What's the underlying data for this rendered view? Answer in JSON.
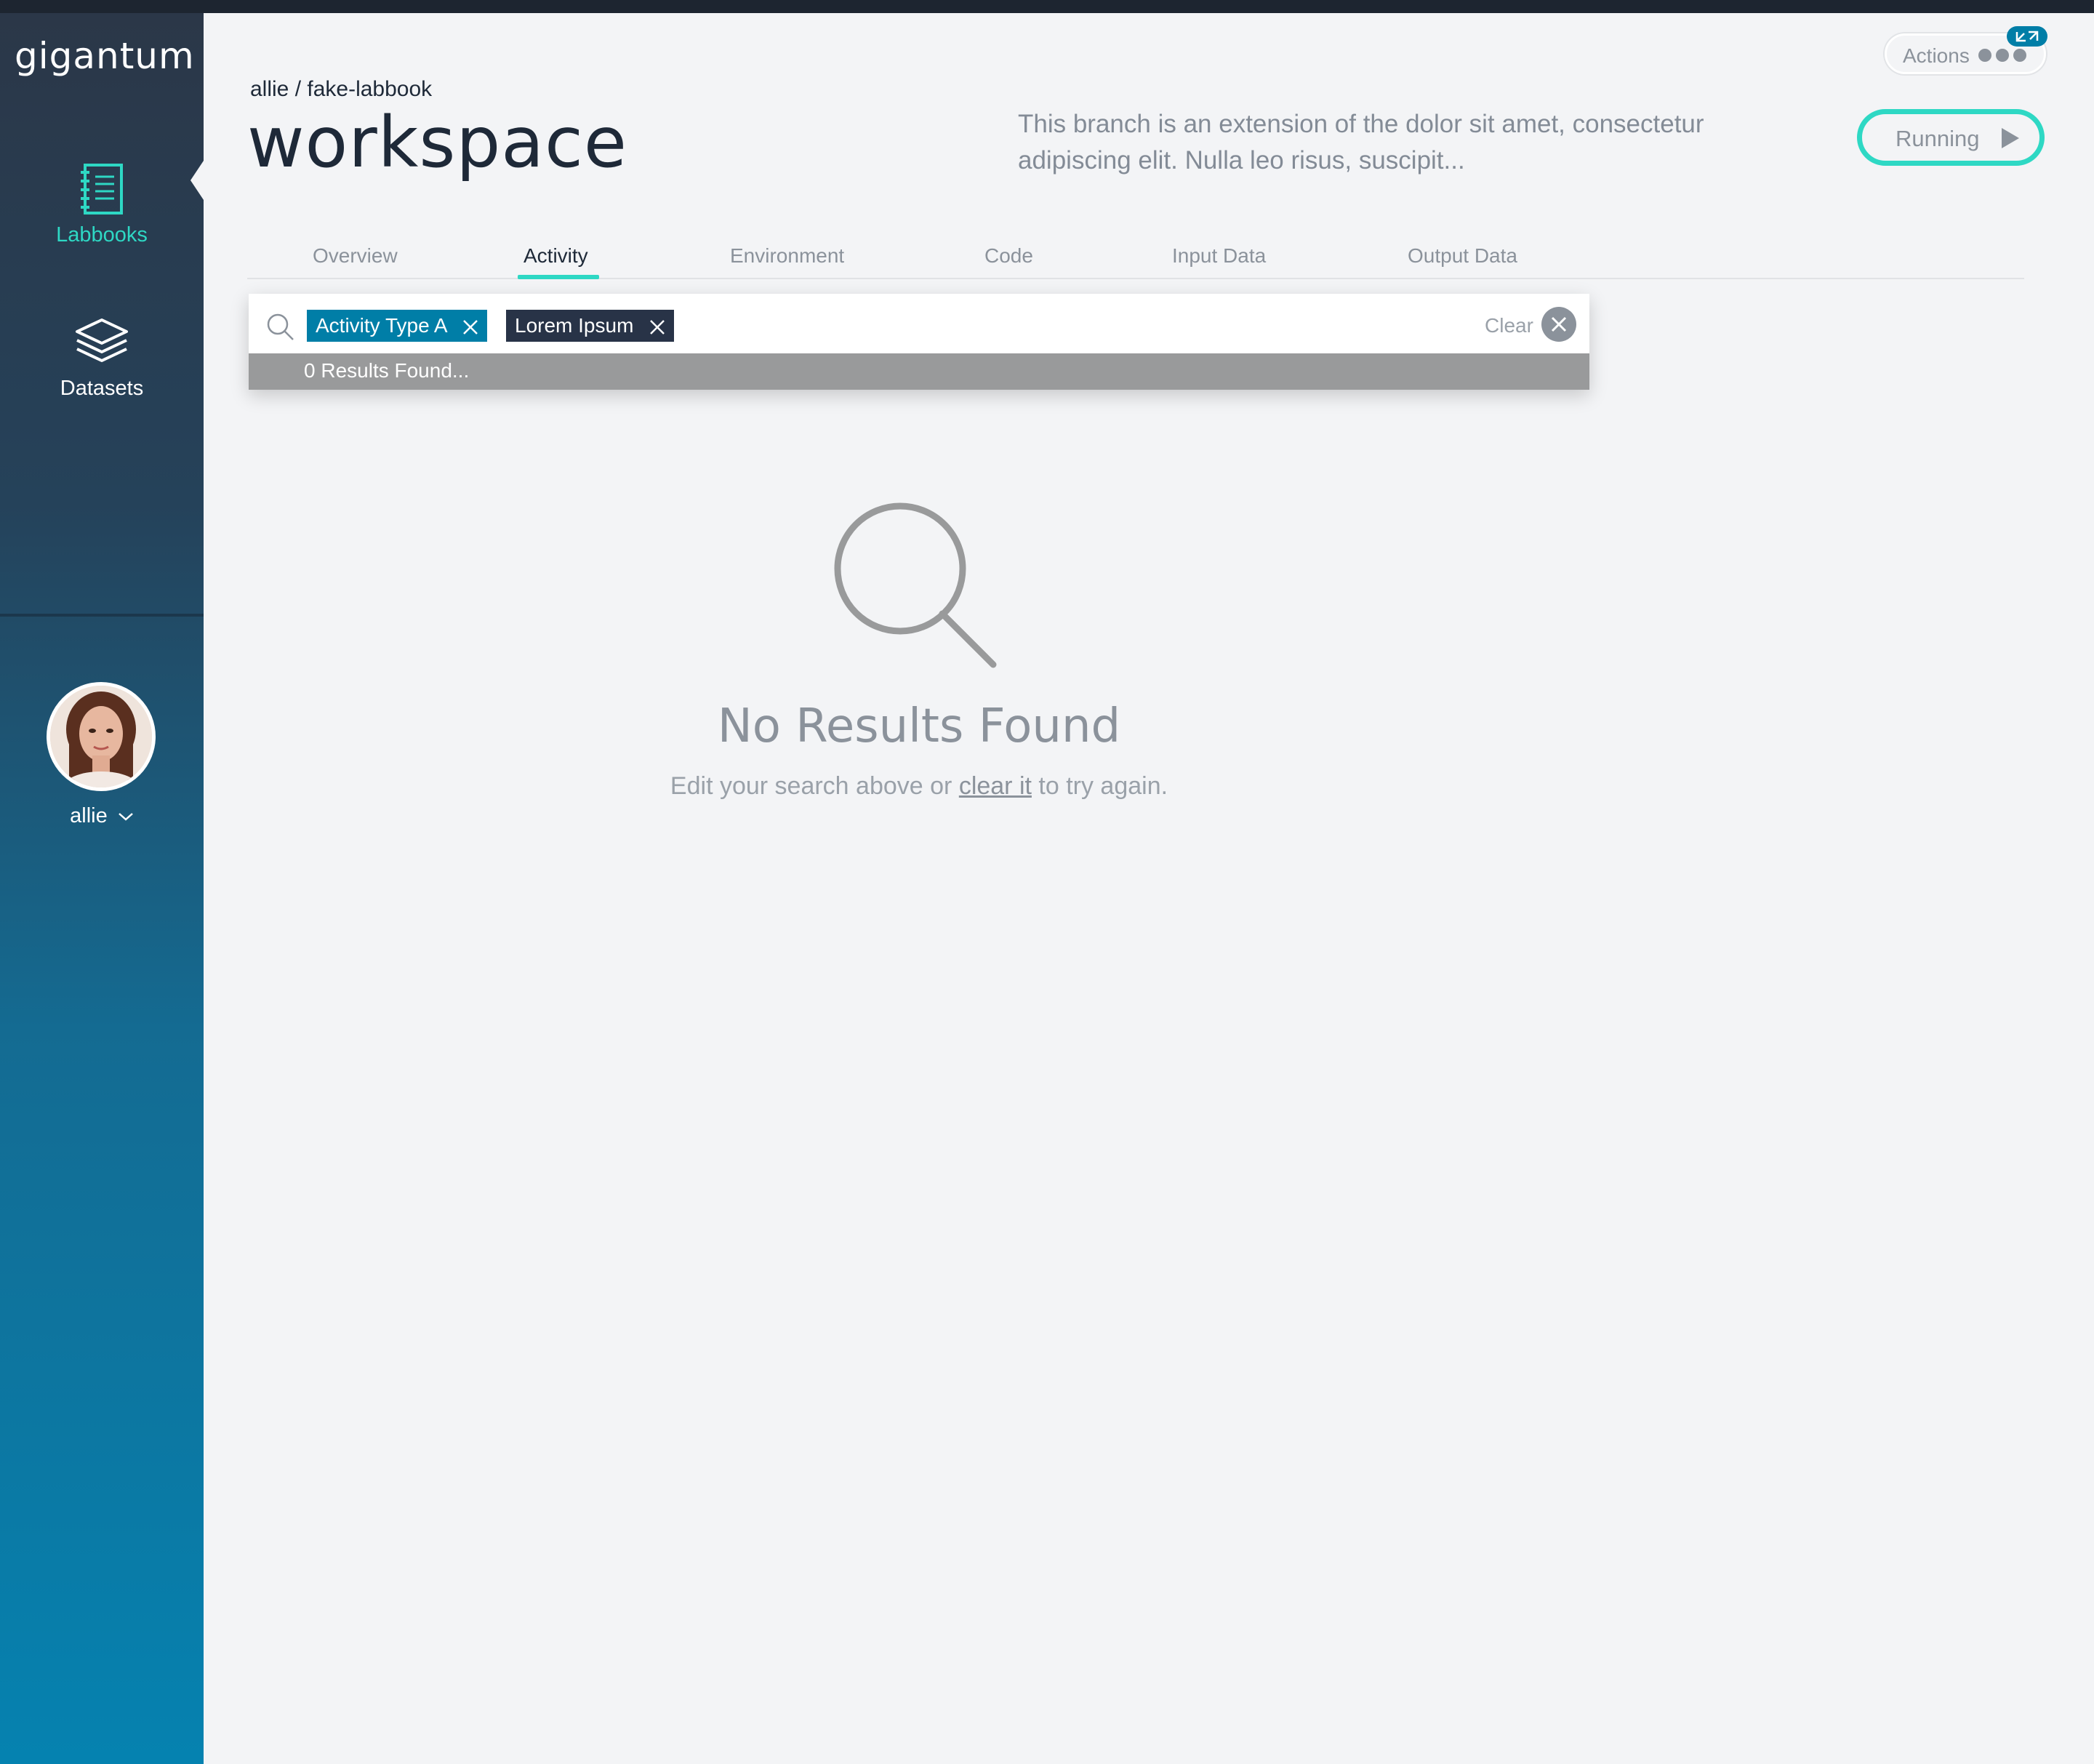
{
  "app": {
    "logo_text": "gigantum"
  },
  "sidebar": {
    "items": [
      {
        "label": "Labbooks",
        "icon": "notebook-icon",
        "active": true
      },
      {
        "label": "Datasets",
        "icon": "layers-icon",
        "active": false
      }
    ],
    "user": {
      "name": "allie"
    }
  },
  "header": {
    "breadcrumb": "allie / fake-labbook",
    "title": "workspace",
    "description": "This branch is an extension of the dolor sit amet, consectetur adipiscing elit. Nulla leo risus, suscipit...",
    "actions_label": "Actions",
    "run_status": "Running"
  },
  "tabs": [
    {
      "label": "Overview"
    },
    {
      "label": "Activity",
      "active": true
    },
    {
      "label": "Environment"
    },
    {
      "label": "Code"
    },
    {
      "label": "Input Data"
    },
    {
      "label": "Output Data"
    }
  ],
  "search": {
    "filters": [
      "Activity Type A",
      "Lorem Ipsum"
    ],
    "clear_label": "Clear",
    "results_text": "0 Results Found..."
  },
  "empty_state": {
    "title": "No Results Found",
    "hint_before": "Edit your search above or ",
    "hint_link": "clear it",
    "hint_after": " to try again."
  },
  "colors": {
    "accent": "#2ed8c4",
    "chip_primary": "#007ea7",
    "chip_secondary": "#283347",
    "sidebar_top": "#2b3748",
    "sidebar_bottom": "#0582b0"
  }
}
